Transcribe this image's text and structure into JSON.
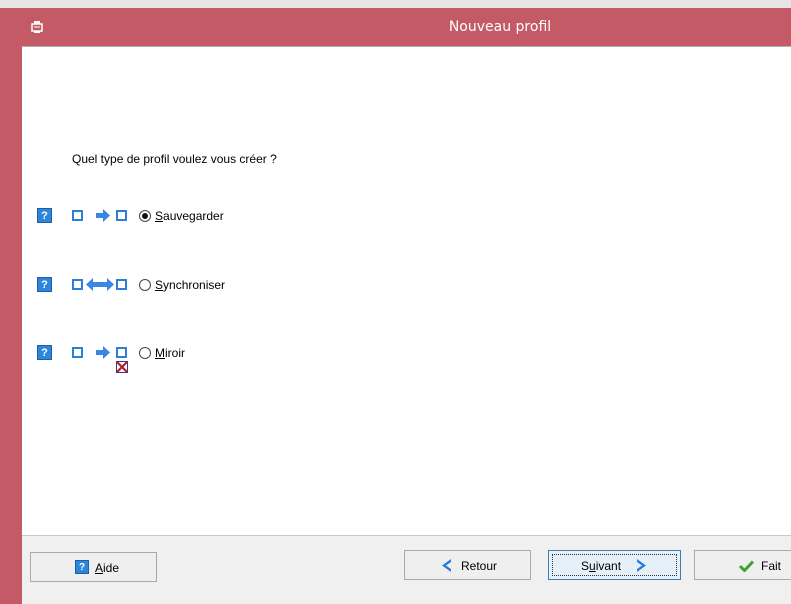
{
  "window": {
    "title": "Nouveau profil"
  },
  "colors": {
    "titlebar": "#c45a66",
    "accent": "#2c7fd6",
    "arrow": "#3a86e0",
    "remove_mark": "#b01f2c"
  },
  "question": "Quel type de profil voulez vous créer ?",
  "options": [
    {
      "acc": "S",
      "rest": "auvegarder",
      "selected": true,
      "icon": "one-way-arrow-icon"
    },
    {
      "acc": "S",
      "rest": "ynchroniser",
      "selected": false,
      "icon": "two-way-arrow-icon"
    },
    {
      "acc": "M",
      "rest": "iroir",
      "selected": false,
      "icon": "mirror-arrow-icon"
    }
  ],
  "buttons": {
    "aide": {
      "acc": "A",
      "rest": "ide"
    },
    "retour": {
      "label": "Retour"
    },
    "suivant": {
      "pre": "S",
      "acc": "u",
      "rest": "ivant"
    },
    "fait": {
      "label": "Fait"
    }
  }
}
